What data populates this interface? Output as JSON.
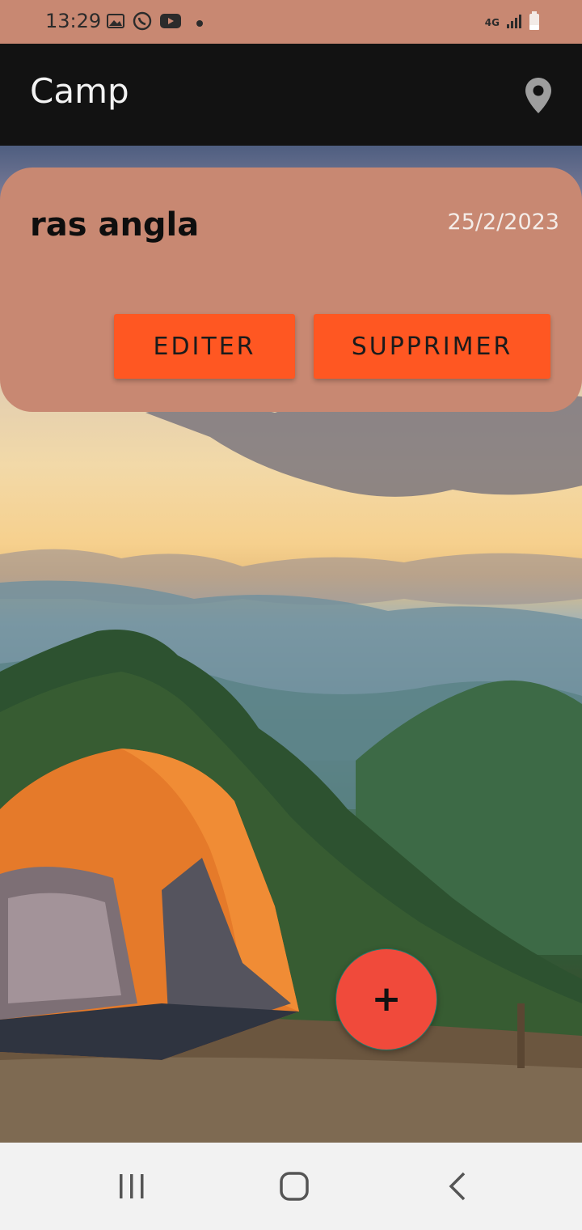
{
  "status_bar": {
    "time": "13:29",
    "left_icons": [
      "image-icon",
      "whatsapp-icon",
      "youtube-icon",
      "dot-icon"
    ],
    "right_icons": [
      "4g-icon",
      "signal-icon",
      "battery-icon"
    ],
    "network_label": "4G"
  },
  "app_bar": {
    "title": "Camp",
    "action_icon": "location-pin-icon"
  },
  "card": {
    "title": "ras angla",
    "date": "25/2/2023",
    "edit_label": "EDITER",
    "delete_label": "SUPPRIMER"
  },
  "fab": {
    "label": "+"
  },
  "nav_bar": {
    "buttons": [
      "recent-apps-icon",
      "home-icon",
      "back-icon"
    ]
  },
  "colors": {
    "status_bar": "#c88872",
    "app_bar": "#121212",
    "card": "#c88872",
    "button": "#ff5722",
    "fab": "#f04a3b",
    "nav_bar": "#f2f2f2"
  }
}
